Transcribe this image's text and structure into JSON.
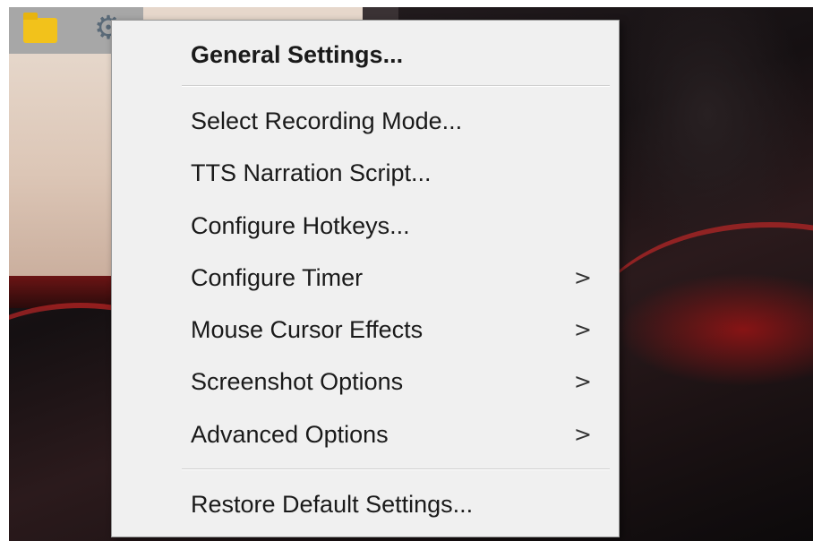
{
  "taskbar": {
    "icons": [
      {
        "name": "folder-icon"
      },
      {
        "name": "gear-icon",
        "glyph": "⚙"
      }
    ]
  },
  "context_menu": {
    "items": [
      {
        "label": "General Settings...",
        "bold": true,
        "submenu": false
      },
      {
        "label": "Select Recording Mode...",
        "bold": false,
        "submenu": false
      },
      {
        "label": "TTS Narration Script...",
        "bold": false,
        "submenu": false
      },
      {
        "label": "Configure Hotkeys...",
        "bold": false,
        "submenu": false
      },
      {
        "label": "Configure Timer",
        "bold": false,
        "submenu": true
      },
      {
        "label": "Mouse Cursor Effects",
        "bold": false,
        "submenu": true
      },
      {
        "label": "Screenshot Options",
        "bold": false,
        "submenu": true
      },
      {
        "label": "Advanced Options",
        "bold": false,
        "submenu": true
      },
      {
        "label": "Restore Default Settings...",
        "bold": false,
        "submenu": false
      }
    ],
    "submenu_arrow": ">"
  }
}
